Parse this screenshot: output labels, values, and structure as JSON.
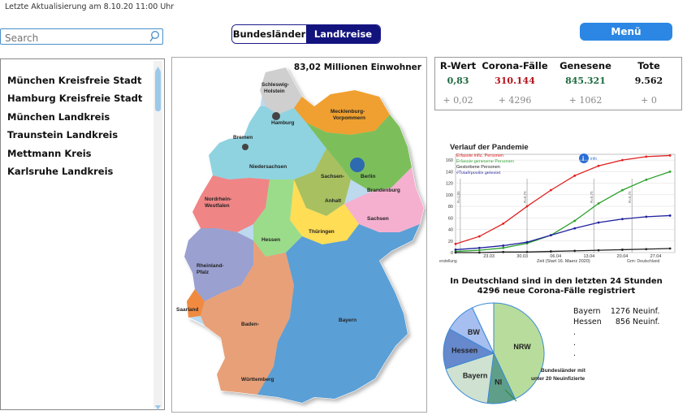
{
  "header": {
    "last_update": "Letzte Aktualisierung am 8.10.20 11:00 Uhr"
  },
  "search": {
    "placeholder": "Search"
  },
  "toggle": {
    "option1": "Bundesländer",
    "option2": "Landkreise",
    "selected": "Landkreise"
  },
  "menu": {
    "label": "Menü"
  },
  "list": {
    "items": [
      "München Kreisfreie Stadt",
      "Hamburg Kreisfreie Stadt",
      "München Landkreis",
      "Traunstein Landkreis",
      "Mettmann Kreis",
      "Karlsruhe Landkreis"
    ]
  },
  "map": {
    "population": "83,02 Millionen Einwohner",
    "labels": [
      "Schleswig-",
      "Holstein",
      "Hamburg",
      "Mecklenburg-",
      "Vorpommern",
      "Bremen",
      "Niedersachsen",
      "Berlin",
      "Brandenburg",
      "Sachsen-",
      "Anhalt",
      "Nordrhein-",
      "Westfalen",
      "Hessen",
      "Thüringen",
      "Sachsen",
      "Rheinland-",
      "Pfalz",
      "Saarland",
      "Baden-",
      "Württemberg",
      "Bayern"
    ]
  },
  "stats": {
    "headers": [
      "R-Wert",
      "Corona-Fälle",
      "Genesene",
      "Tote"
    ],
    "values": [
      "0,83",
      "310.144",
      "845.321",
      "9.562"
    ],
    "value_colors": [
      "#1d6b3e",
      "#b5121b",
      "#1d6b3e",
      "#111111"
    ],
    "changes": [
      "+ 0,02",
      "+ 4296",
      "+ 1062",
      "+ 0"
    ]
  },
  "pandemic_chart": {
    "title": "Verlauf der Pandemie",
    "legend": [
      "Erfasste infiz. Personen",
      "Erfasste genesene Personen",
      "Gestorbene Personen",
      "#Total#positiv getestet"
    ],
    "info": "info",
    "r_labels": [
      "R=1,05",
      "R=0,75",
      "R=0,75",
      "R=0,75"
    ],
    "left_note": "erstellung",
    "source_note": "Grm: Deutschland"
  },
  "chart_data": {
    "type": "line",
    "title": "Verlauf der Pandemie",
    "xlabel": "Zeit (Start 16. Maerz 2020)",
    "ylabel": "",
    "x_ticks": [
      "23.03",
      "30.03",
      "06.04",
      "13.04",
      "20.04",
      "27.04"
    ],
    "y_ticks": [
      0,
      20,
      40,
      60,
      80,
      100,
      120,
      140,
      160
    ],
    "ylim": [
      0,
      170
    ],
    "xlim": [
      0,
      46
    ],
    "x": [
      0,
      5,
      10,
      15,
      20,
      25,
      30,
      35,
      40,
      45
    ],
    "series": [
      {
        "name": "Erfasste infiz. Personen",
        "color": "#e02020",
        "values": [
          15,
          28,
          50,
          80,
          108,
          133,
          150,
          160,
          166,
          168
        ]
      },
      {
        "name": "Erfasste genesene Personen",
        "color": "#2aa02a",
        "values": [
          2,
          4,
          8,
          16,
          30,
          55,
          85,
          108,
          126,
          140
        ]
      },
      {
        "name": "Gestorbene Personen",
        "color": "#222222",
        "values": [
          0,
          0,
          1,
          1,
          2,
          3,
          4,
          5,
          6,
          7
        ]
      },
      {
        "name": "#Total#positiv getestet",
        "color": "#2020a0",
        "values": [
          5,
          8,
          12,
          18,
          30,
          42,
          52,
          58,
          62,
          64
        ]
      }
    ],
    "grid": true
  },
  "pie": {
    "heading1": "In Deutschland sind in den letzten 24 Stunden",
    "heading2": "4296 neue Corona-Fälle registriert",
    "note1": "Bundesländer mit",
    "note2": "unter 20 Neuinfizierte",
    "slices": [
      {
        "label": "NRW",
        "value": 43,
        "color": "#b8dc9c"
      },
      {
        "label": "NI",
        "value": 9,
        "color": "#5f9f8a"
      },
      {
        "label": "Bayern",
        "value": 18,
        "color": "#cfe1d0"
      },
      {
        "label": "Hessen",
        "value": 13,
        "color": "#6688cc"
      },
      {
        "label": "BW",
        "value": 10,
        "color": "#a7bff0"
      },
      {
        "label": "",
        "value": 7,
        "color": "#ffffff"
      }
    ]
  },
  "pie_legend": {
    "rows": [
      [
        "Bayern",
        "1276",
        "Neuinf."
      ],
      [
        "Hessen",
        "856",
        "Neuinf."
      ]
    ],
    "dots": [
      ".",
      ".",
      "."
    ]
  }
}
